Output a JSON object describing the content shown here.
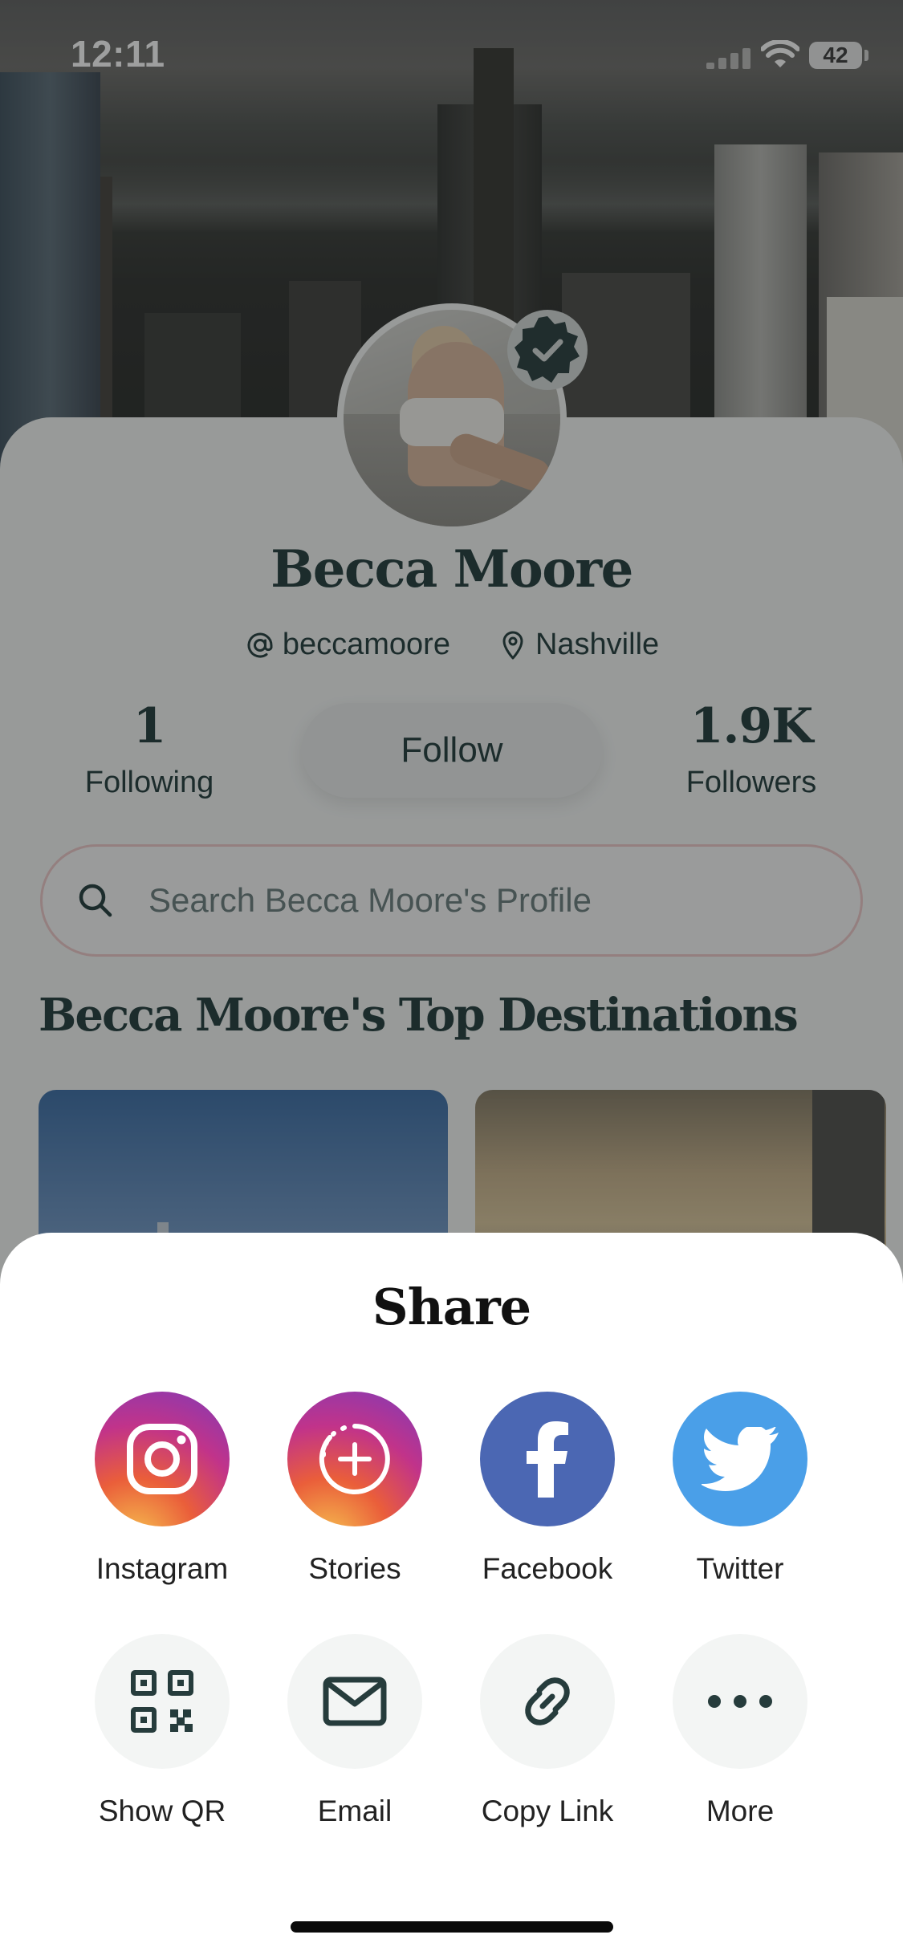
{
  "status_bar": {
    "time": "12:11",
    "battery": "42"
  },
  "profile": {
    "name": "Becca Moore",
    "handle": "beccamoore",
    "location": "Nashville",
    "following_count": "1",
    "following_label": "Following",
    "followers_count": "1.9K",
    "followers_label": "Followers",
    "follow_label": "Follow",
    "verified": true
  },
  "search": {
    "placeholder": "Search Becca Moore's Profile"
  },
  "destinations": {
    "title": "Becca Moore's Top Destinations"
  },
  "share_sheet": {
    "title": "Share",
    "options": [
      {
        "label": "Instagram",
        "icon": "instagram-icon"
      },
      {
        "label": "Stories",
        "icon": "stories-icon"
      },
      {
        "label": "Facebook",
        "icon": "facebook-icon"
      },
      {
        "label": "Twitter",
        "icon": "twitter-icon"
      },
      {
        "label": "Show QR",
        "icon": "qr-code-icon"
      },
      {
        "label": "Email",
        "icon": "mail-icon"
      },
      {
        "label": "Copy Link",
        "icon": "link-icon"
      },
      {
        "label": "More",
        "icon": "more-icon"
      }
    ]
  },
  "colors": {
    "brand_text": "#1f3a3a",
    "facebook": "#4b67b3",
    "twitter": "#4a9fe8",
    "search_border": "#eec9c9"
  }
}
